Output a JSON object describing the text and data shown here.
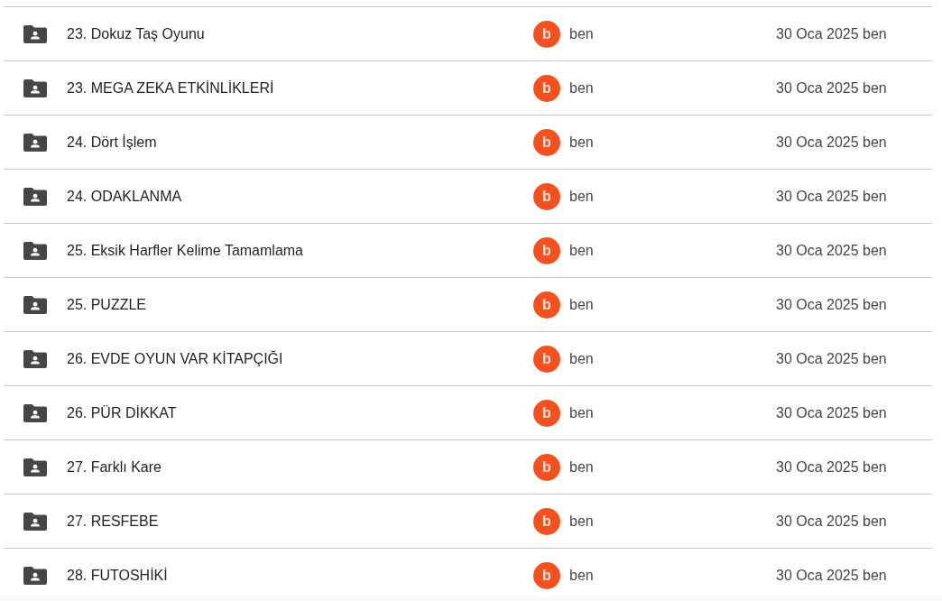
{
  "rows": [
    {
      "name": "23. Dokuz Taş Oyunu",
      "owner": {
        "initial": "b",
        "name": "ben"
      },
      "modified": "30 Oca 2025 ben"
    },
    {
      "name": "23. MEGA ZEKA ETKİNLİKLERİ",
      "owner": {
        "initial": "b",
        "name": "ben"
      },
      "modified": "30 Oca 2025 ben"
    },
    {
      "name": "24. Dört İşlem",
      "owner": {
        "initial": "b",
        "name": "ben"
      },
      "modified": "30 Oca 2025 ben"
    },
    {
      "name": "24. ODAKLANMA",
      "owner": {
        "initial": "b",
        "name": "ben"
      },
      "modified": "30 Oca 2025 ben"
    },
    {
      "name": "25. Eksik Harfler Kelime Tamamlama",
      "owner": {
        "initial": "b",
        "name": "ben"
      },
      "modified": "30 Oca 2025 ben"
    },
    {
      "name": "25. PUZZLE",
      "owner": {
        "initial": "b",
        "name": "ben"
      },
      "modified": "30 Oca 2025 ben"
    },
    {
      "name": "26. EVDE OYUN VAR KİTAPÇIĞI",
      "owner": {
        "initial": "b",
        "name": "ben"
      },
      "modified": "30 Oca 2025 ben"
    },
    {
      "name": "26. PÜR DİKKAT",
      "owner": {
        "initial": "b",
        "name": "ben"
      },
      "modified": "30 Oca 2025 ben"
    },
    {
      "name": "27. Farklı Kare",
      "owner": {
        "initial": "b",
        "name": "ben"
      },
      "modified": "30 Oca 2025 ben"
    },
    {
      "name": "27. RESFEBE",
      "owner": {
        "initial": "b",
        "name": "ben"
      },
      "modified": "30 Oca 2025 ben"
    },
    {
      "name": "28. FUTOSHİKİ",
      "owner": {
        "initial": "b",
        "name": "ben"
      },
      "modified": "30 Oca 2025 ben"
    }
  ]
}
